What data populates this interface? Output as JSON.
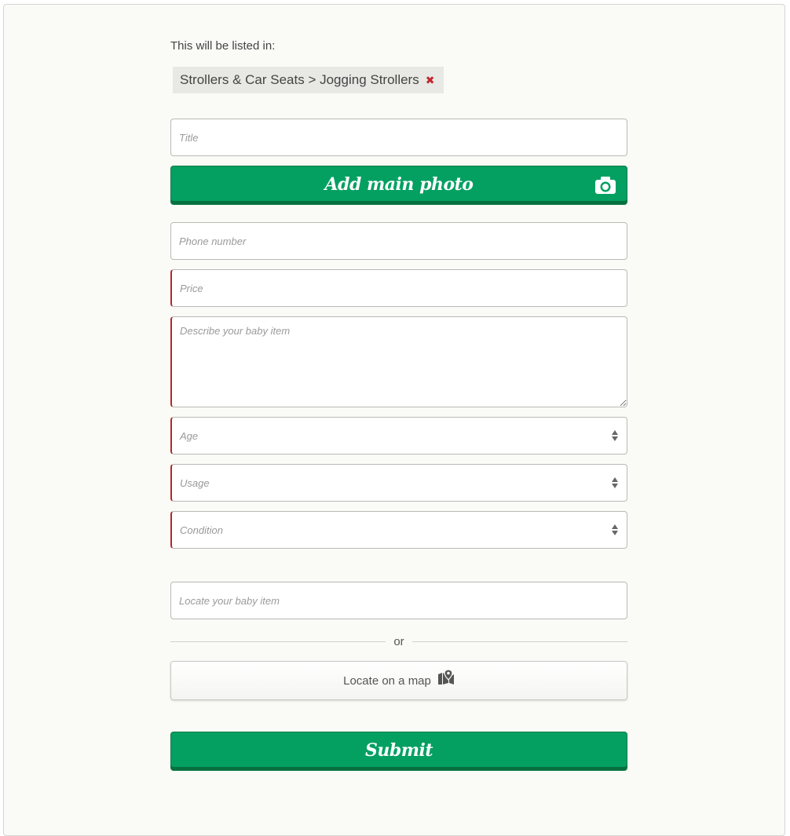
{
  "listing": {
    "listed_in_label": "This will be listed in:",
    "category_path": "Strollers & Car Seats > Jogging Strollers",
    "remove_symbol": "✖"
  },
  "form": {
    "title_placeholder": "Title",
    "add_photo_label": "Add main photo",
    "phone_placeholder": "Phone number",
    "price_placeholder": "Price",
    "description_placeholder": "Describe your baby item",
    "age_label": "Age",
    "usage_label": "Usage",
    "condition_label": "Condition",
    "location_placeholder": "Locate your baby item",
    "or_label": "or",
    "locate_map_label": "Locate on a map",
    "submit_label": "Submit"
  },
  "icons": {
    "camera": "camera-icon",
    "map": "map-marker-icon",
    "select_arrows": "sort-arrows-icon"
  },
  "colors": {
    "primary_green": "#03a062",
    "required_red": "#b3262c",
    "remove_red": "#c0282d"
  }
}
